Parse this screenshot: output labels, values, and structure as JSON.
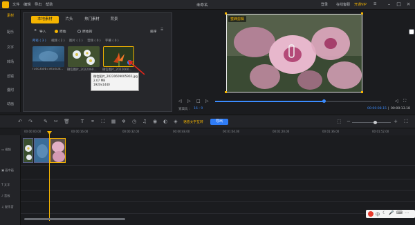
{
  "app": {
    "title": "未命名",
    "menu": [
      "文件",
      "编辑",
      "导出",
      "帮助"
    ],
    "right_menu": [
      "登录",
      "在线客服",
      "开通VIP"
    ],
    "win_controls": [
      "minimize-icon",
      "maximize-icon",
      "close-icon"
    ]
  },
  "sidebar": {
    "items": [
      {
        "label": "素材",
        "active": true
      },
      {
        "label": "配乐"
      },
      {
        "label": "文字"
      },
      {
        "label": "转场"
      },
      {
        "label": "滤镜"
      },
      {
        "label": "叠附"
      },
      {
        "label": "动画"
      }
    ]
  },
  "media": {
    "tabs": [
      "本地素材",
      "片头",
      "热门素材",
      "背景"
    ],
    "import_label": "导入",
    "radio1": "原始",
    "radio2": "原始的",
    "sort_label": "排序",
    "filters": [
      "所有 ( 3 )",
      "视频 ( 2 )",
      "图片 ( 1 )",
      "音频 ( 0 )",
      "字幕 ( 0 )"
    ],
    "thumbs": [
      {
        "label": "73dc3a0b73e54caf..."
      },
      {
        "label": "微信图片_2022060..."
      },
      {
        "label": "微信图片_2022060..."
      }
    ],
    "tooltip": {
      "name": "微信图片_20220609005902.jpg",
      "size": "2.07 MB",
      "resolution": "1920x1440"
    }
  },
  "preview": {
    "watermark": "蜜蜂剪辑",
    "time_current": "00:00:08.15",
    "time_total": "00:00:13.18",
    "aspect_label": "宽高比 :",
    "aspect_value": "16 : 9",
    "progress": 0.65
  },
  "toolbar": {
    "subtitle_label": "语音文字互转",
    "export_label": "导出"
  },
  "timeline": {
    "ticks": [
      "00:00:00.00",
      "00:00:16.00",
      "00:00:32.00",
      "00:00:48.00",
      "00:01:04.00",
      "00:01:20.00",
      "00:01:36.00",
      "00:01:52.00"
    ],
    "tracks": [
      "视频",
      "画中画",
      "文字",
      "音效",
      "配乐音"
    ]
  },
  "tray": {
    "label": "中"
  },
  "colors": {
    "accent": "#f5b400",
    "primary": "#2f7cf6",
    "bg": "#1b1c1f"
  }
}
